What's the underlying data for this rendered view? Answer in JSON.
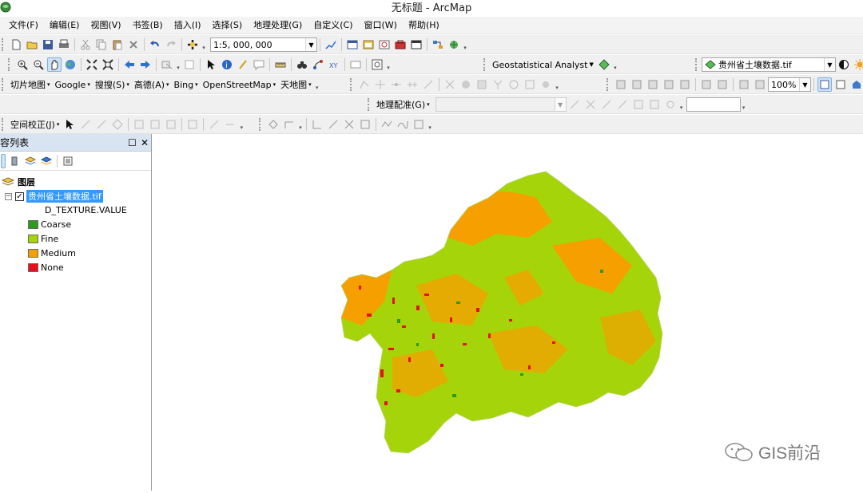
{
  "window": {
    "title": "无标题 - ArcMap"
  },
  "menu": [
    "文件(F)",
    "编辑(E)",
    "视图(V)",
    "书签(B)",
    "插入(I)",
    "选择(S)",
    "地理处理(G)",
    "自定义(C)",
    "窗口(W)",
    "帮助(H)"
  ],
  "toolbar": {
    "scale_value": "1:5, 000, 000",
    "geostatistical_label": "Geostatistical Analyst",
    "layer_combo_value": "贵州省土壤数据.tif",
    "zoom_percent": "100%",
    "basemap_menus": [
      "切片地图",
      "Google",
      "搜搜(S)",
      "高德(A)",
      "Bing",
      "OpenStreetMap",
      "天地图"
    ],
    "georeferencing_label": "地理配准(G)",
    "spatial_adjustment_label": "空间校正(J)"
  },
  "toc": {
    "title": "容列表",
    "layers_group": "图层",
    "layer_name": "贵州省土壤数据.tif",
    "field_name": "D_TEXTURE.VALUE",
    "legend": [
      {
        "label": "Coarse",
        "color": "#2e9a1e"
      },
      {
        "label": "Fine",
        "color": "#a6d40a"
      },
      {
        "label": "Medium",
        "color": "#f5a000"
      },
      {
        "label": "None",
        "color": "#e8101a"
      }
    ]
  },
  "map": {
    "colors": {
      "fine": "#a6d40a",
      "medium": "#f5a000",
      "none": "#e8101a",
      "coarse": "#2e9a1e"
    }
  },
  "watermark": "GIS前沿",
  "icons": [
    "new-file-icon",
    "open-folder-icon",
    "save-icon",
    "print-icon",
    "cut-icon",
    "copy-icon",
    "paste-icon",
    "delete-icon",
    "undo-icon",
    "redo-icon",
    "add-data-icon",
    "zoom-in-icon",
    "zoom-out-icon",
    "pan-icon",
    "globe-icon",
    "select-arrow-icon",
    "identify-icon",
    "find-binoculars-icon",
    "geostatistical-icon",
    "contrast-icon",
    "sun-icon",
    "close-icon",
    "pin-icon"
  ]
}
